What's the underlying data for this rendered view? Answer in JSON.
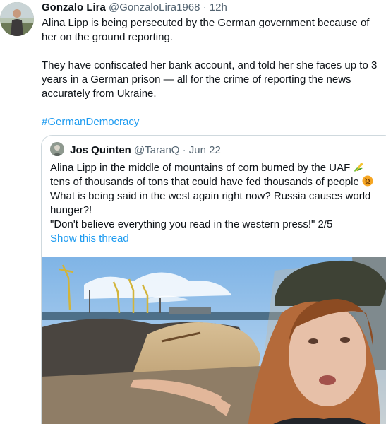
{
  "tweet": {
    "display_name": "Gonzalo Lira",
    "handle": "@GonzaloLira1968",
    "separator": "·",
    "time": "12h",
    "paragraph_1": "Alina Lipp is being persecuted by the German government because of her on the ground reporting.",
    "paragraph_2": "They have confiscated her bank account, and told her she faces up to 3 years in a German prison — all for the crime of reporting the news accurately from Ukraine.",
    "hashtag": "#GermanDemocracy"
  },
  "quote": {
    "display_name": "Jos Quinten",
    "handle": "@TaranQ",
    "separator": "·",
    "time": "Jun 22",
    "line_1": "Alina Lipp in the middle of mountains of corn burned by the UAF",
    "line_2": "tens of thousands of tons that could have fed thousands of people",
    "line_3": "What is being said in the west again right now? Russia causes world hunger?!",
    "line_4": "\"Don't believe everything you read in the western press!\" 2/5",
    "show_thread": "Show this thread",
    "emoji_1": "corn-emoji",
    "emoji_2": "angry-face-emoji"
  },
  "colors": {
    "link": "#1d9bf0",
    "secondary_text": "#536471",
    "border": "#cfd9de"
  }
}
